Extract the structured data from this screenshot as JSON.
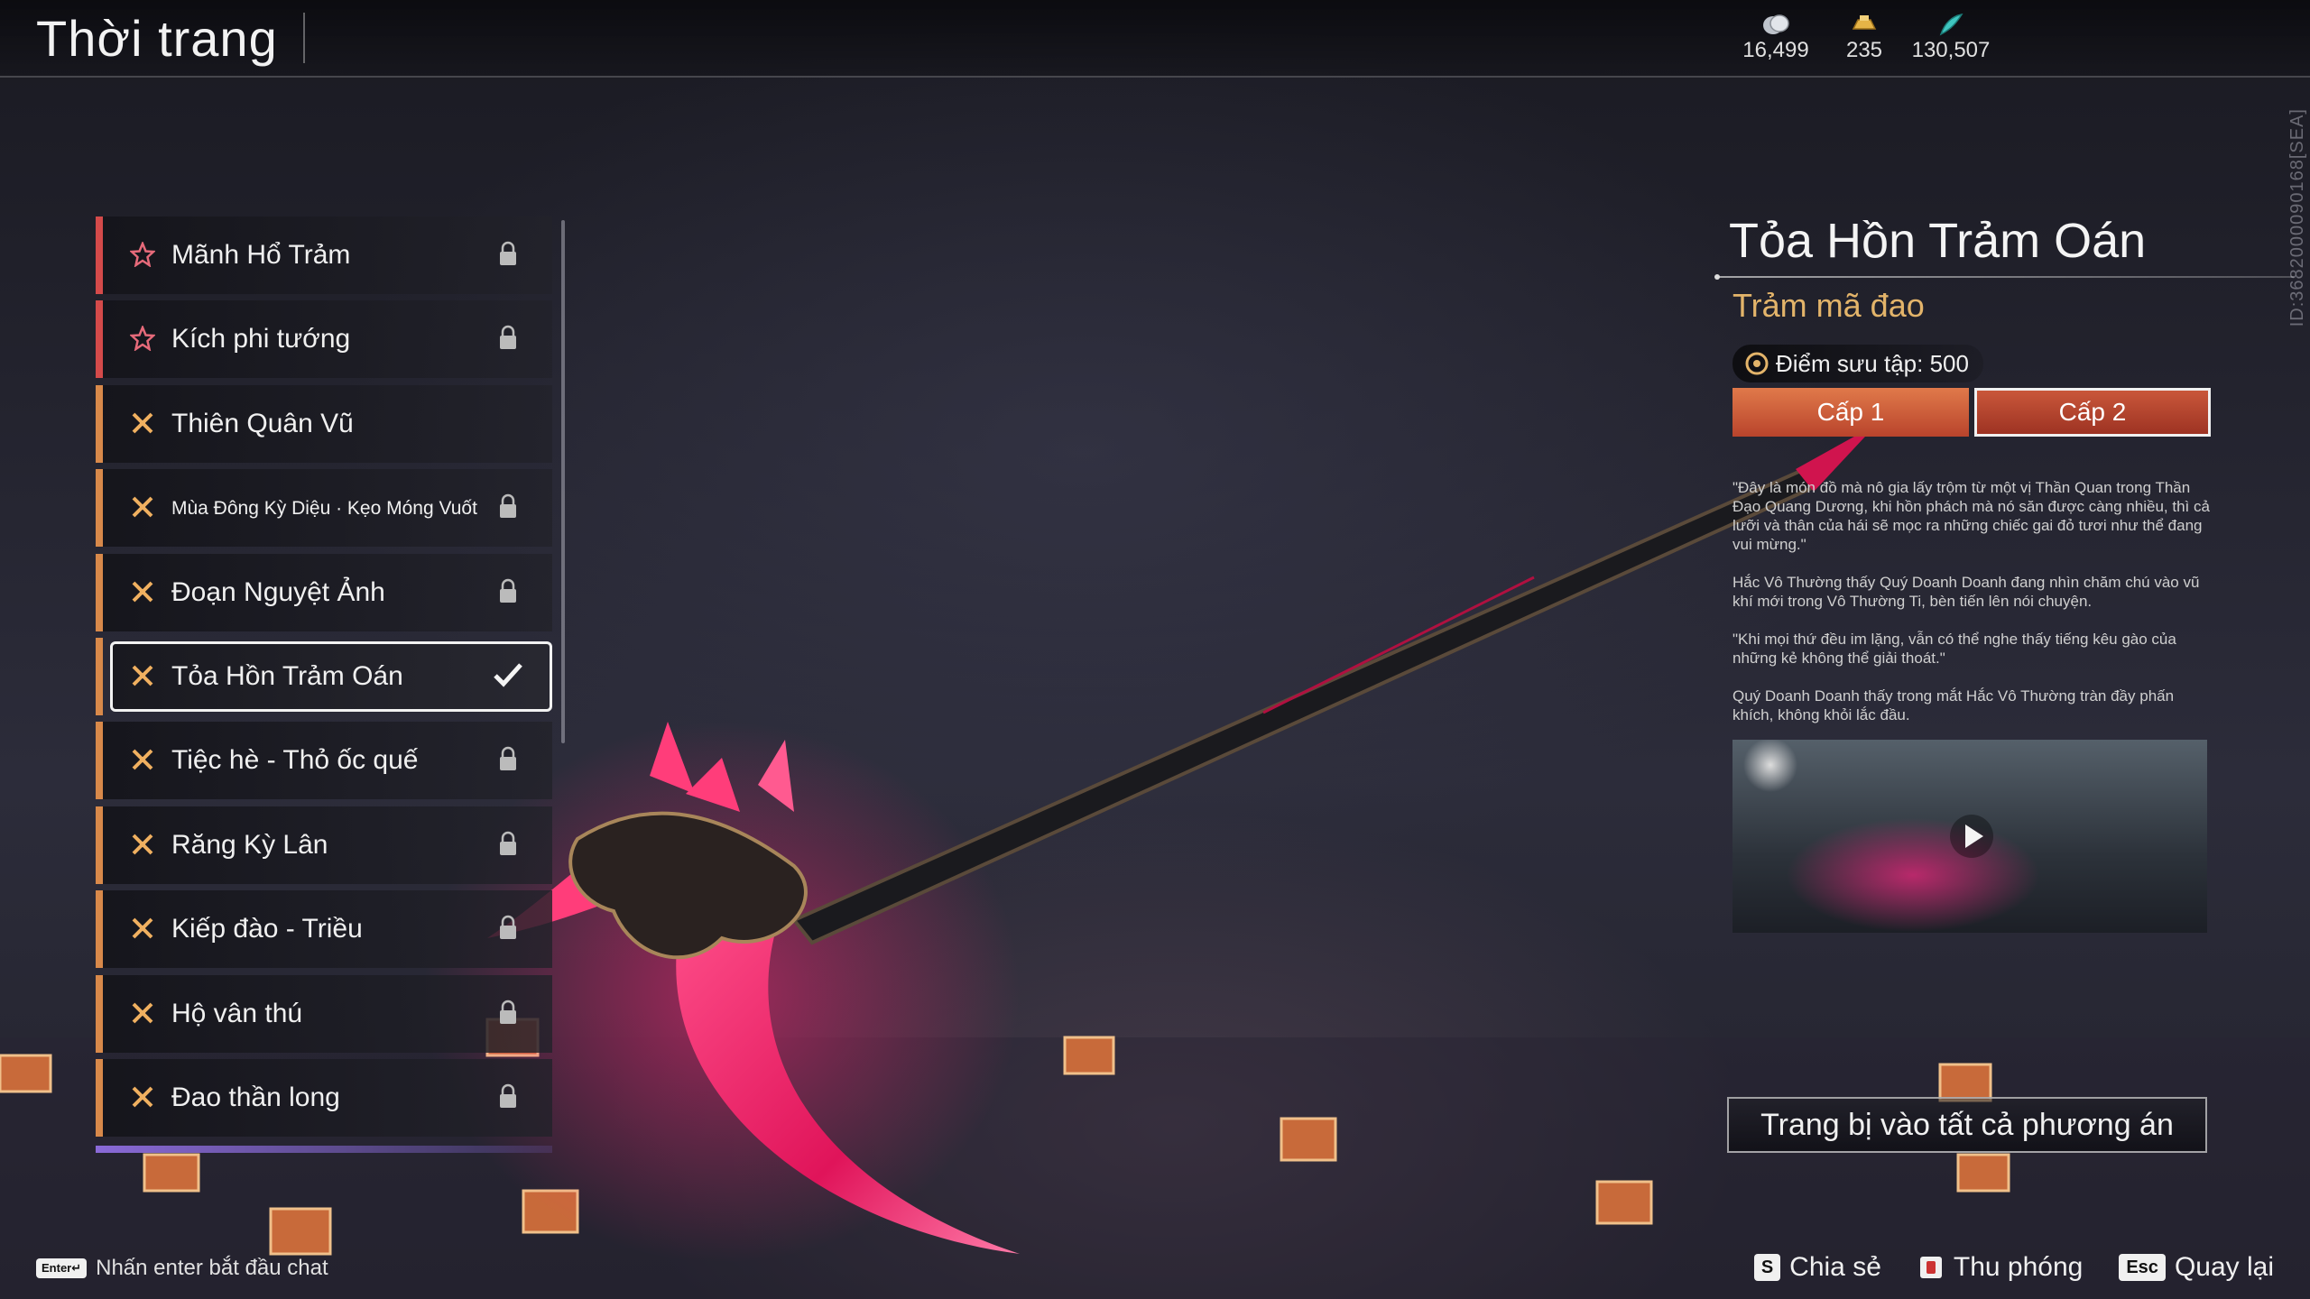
{
  "header": {
    "title": "Thời trang",
    "currencies": [
      {
        "icon": "silver-coin-icon",
        "value": "16,499"
      },
      {
        "icon": "gold-ingot-icon",
        "value": "235"
      },
      {
        "icon": "jade-feather-icon",
        "value": "130,507"
      }
    ],
    "server_id": "ID:3682000090168[SEA]"
  },
  "skin_list": [
    {
      "label": "Mãnh Hổ Trảm",
      "rarity": "red",
      "locked": true
    },
    {
      "label": "Kích phi tướng",
      "rarity": "red",
      "locked": true
    },
    {
      "label": "Thiên Quân Vũ",
      "rarity": "orange",
      "locked": false
    },
    {
      "label": "Mùa Đông Kỳ Diệu · Kẹo Móng Vuốt",
      "rarity": "orange",
      "locked": true
    },
    {
      "label": "Đoạn Nguyệt Ảnh",
      "rarity": "orange",
      "locked": true
    },
    {
      "label": "Tỏa Hồn Trảm Oán",
      "rarity": "orange",
      "locked": false,
      "selected": true
    },
    {
      "label": "Tiệc hè - Thỏ ốc quế",
      "rarity": "orange",
      "locked": true
    },
    {
      "label": "Răng Kỳ Lân",
      "rarity": "orange",
      "locked": true
    },
    {
      "label": "Kiếp đào - Triều",
      "rarity": "orange",
      "locked": true
    },
    {
      "label": "Hộ vân thú",
      "rarity": "orange",
      "locked": true
    },
    {
      "label": "Đao thần long",
      "rarity": "orange",
      "locked": true
    }
  ],
  "detail": {
    "name": "Tỏa Hồn Trảm Oán",
    "type": "Trảm mã đao",
    "collection_points": "Điểm sưu tập: 500",
    "tiers": [
      "Cấp 1",
      "Cấp 2"
    ],
    "lore": [
      "\"Đây là món đồ mà nô gia lấy trộm từ một vị Thần Quan trong Thần Đạo Quang Dương, khi hồn phách mà nó săn được càng nhiều, thì cả lưỡi và thân của hái sẽ mọc ra những chiếc gai đỏ tươi như thể đang vui mừng.\"",
      "Hắc Vô Thường thấy Quý Doanh Doanh đang nhìn chăm chú vào vũ khí mới trong Vô Thường Ti, bèn tiến lên nói chuyện.",
      "\"Khi mọi thứ đều im lặng, vẫn có thể nghe thấy tiếng kêu gào của những kẻ không thể giải thoát.\"",
      "Quý Doanh Doanh thấy trong mắt Hắc Vô Thường tràn đầy phấn khích, không khỏi lắc đầu."
    ],
    "equip_all_label": "Trang bị vào tất cả phương án"
  },
  "footer": {
    "chat_key": "Enter↵",
    "chat_hint": "Nhấn enter bắt đầu chat",
    "share_key": "S",
    "share_label": "Chia sẻ",
    "zoom_label": "Thu phóng",
    "back_key": "Esc",
    "back_label": "Quay lại"
  },
  "colors": {
    "rarity_red": "#d44a4a",
    "rarity_orange": "#d8894a",
    "accent_gold": "#e3b46a",
    "tier_tab": "#c9573a"
  }
}
